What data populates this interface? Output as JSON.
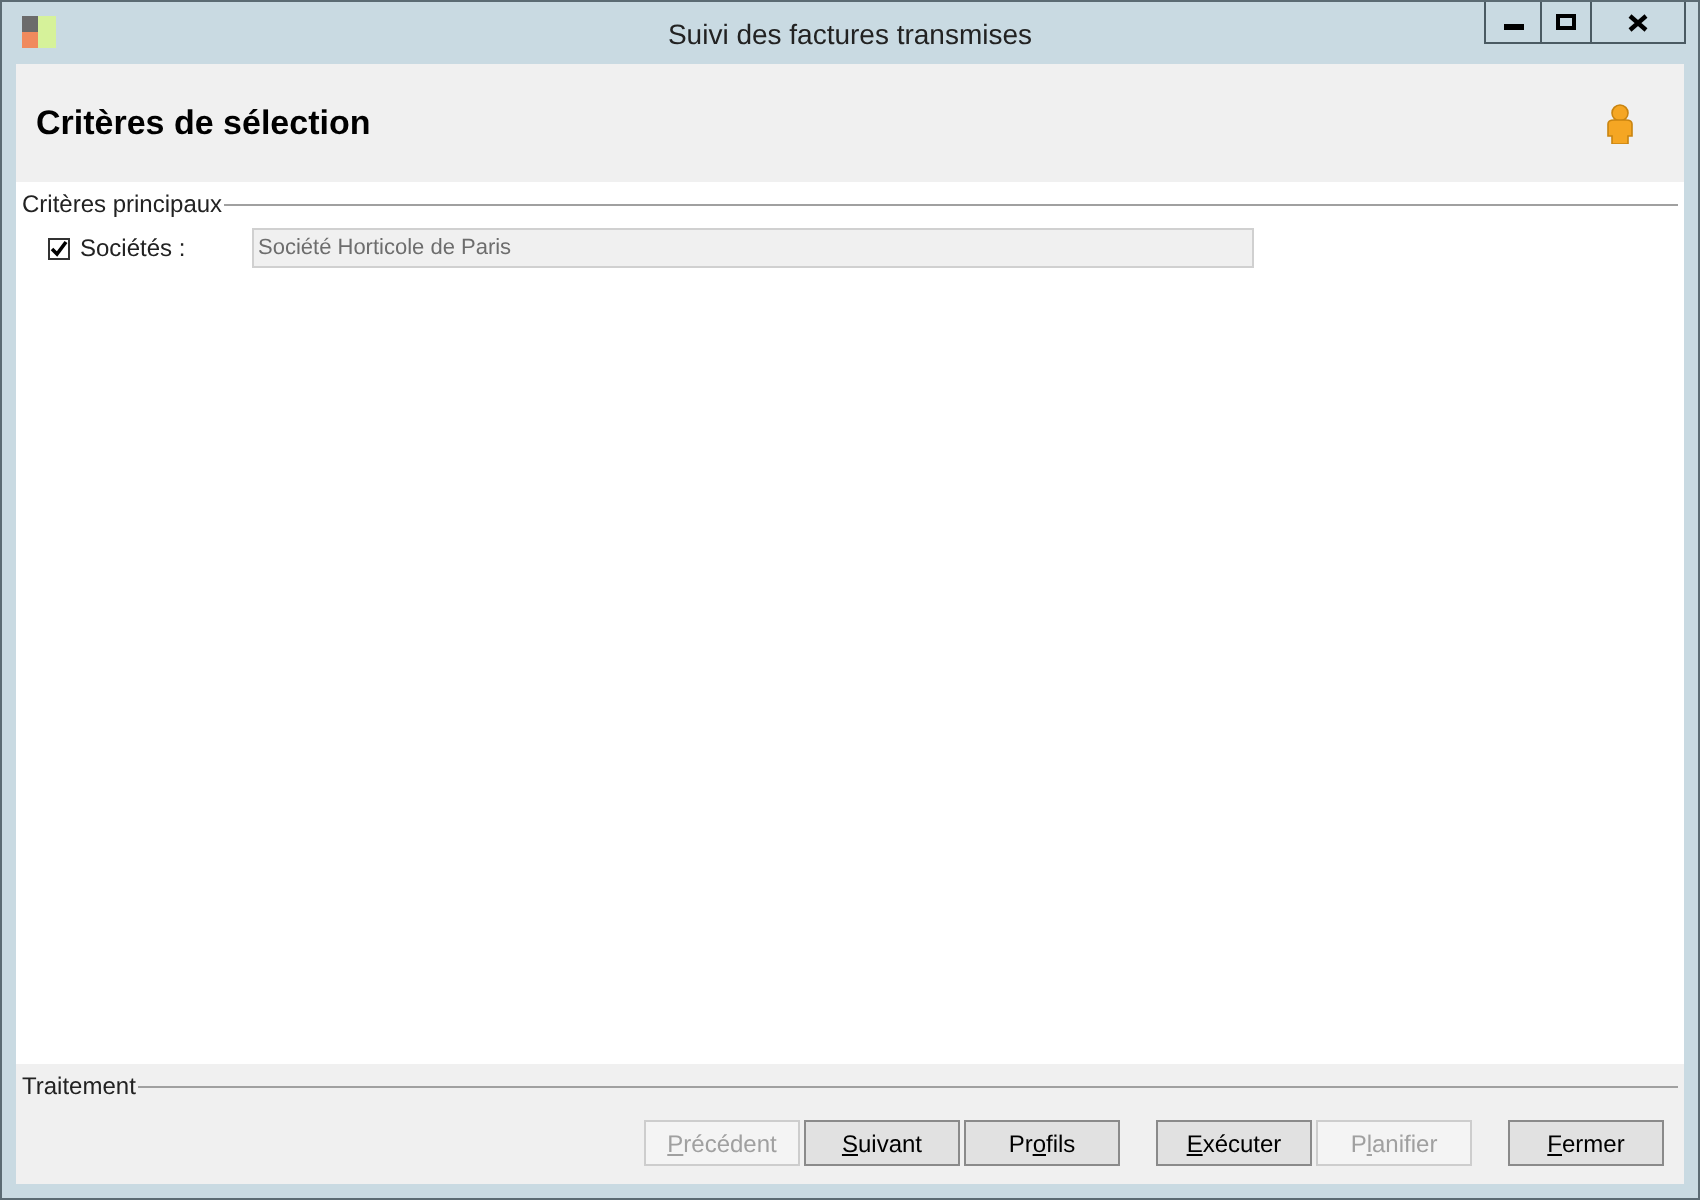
{
  "window": {
    "title": "Suivi des factures transmises"
  },
  "header": {
    "title": "Critères de sélection"
  },
  "main_group": {
    "legend": "Critères principaux",
    "fields": [
      {
        "label": "Sociétés :",
        "checked": true,
        "value": "Société Horticole de Paris"
      }
    ]
  },
  "footer": {
    "legend": "Traitement",
    "button_groups": [
      [
        {
          "key": "P",
          "post": "récédent",
          "disabled": true
        },
        {
          "key": "S",
          "post": "uivant",
          "disabled": false
        },
        {
          "pre": "Pr",
          "key": "o",
          "post": "fils",
          "disabled": false
        }
      ],
      [
        {
          "key": "E",
          "post": "xécuter",
          "disabled": false
        },
        {
          "pre": "P",
          "key": "l",
          "post": "anifier",
          "disabled": true
        }
      ],
      [
        {
          "key": "F",
          "post": "ermer",
          "disabled": false
        }
      ]
    ]
  }
}
